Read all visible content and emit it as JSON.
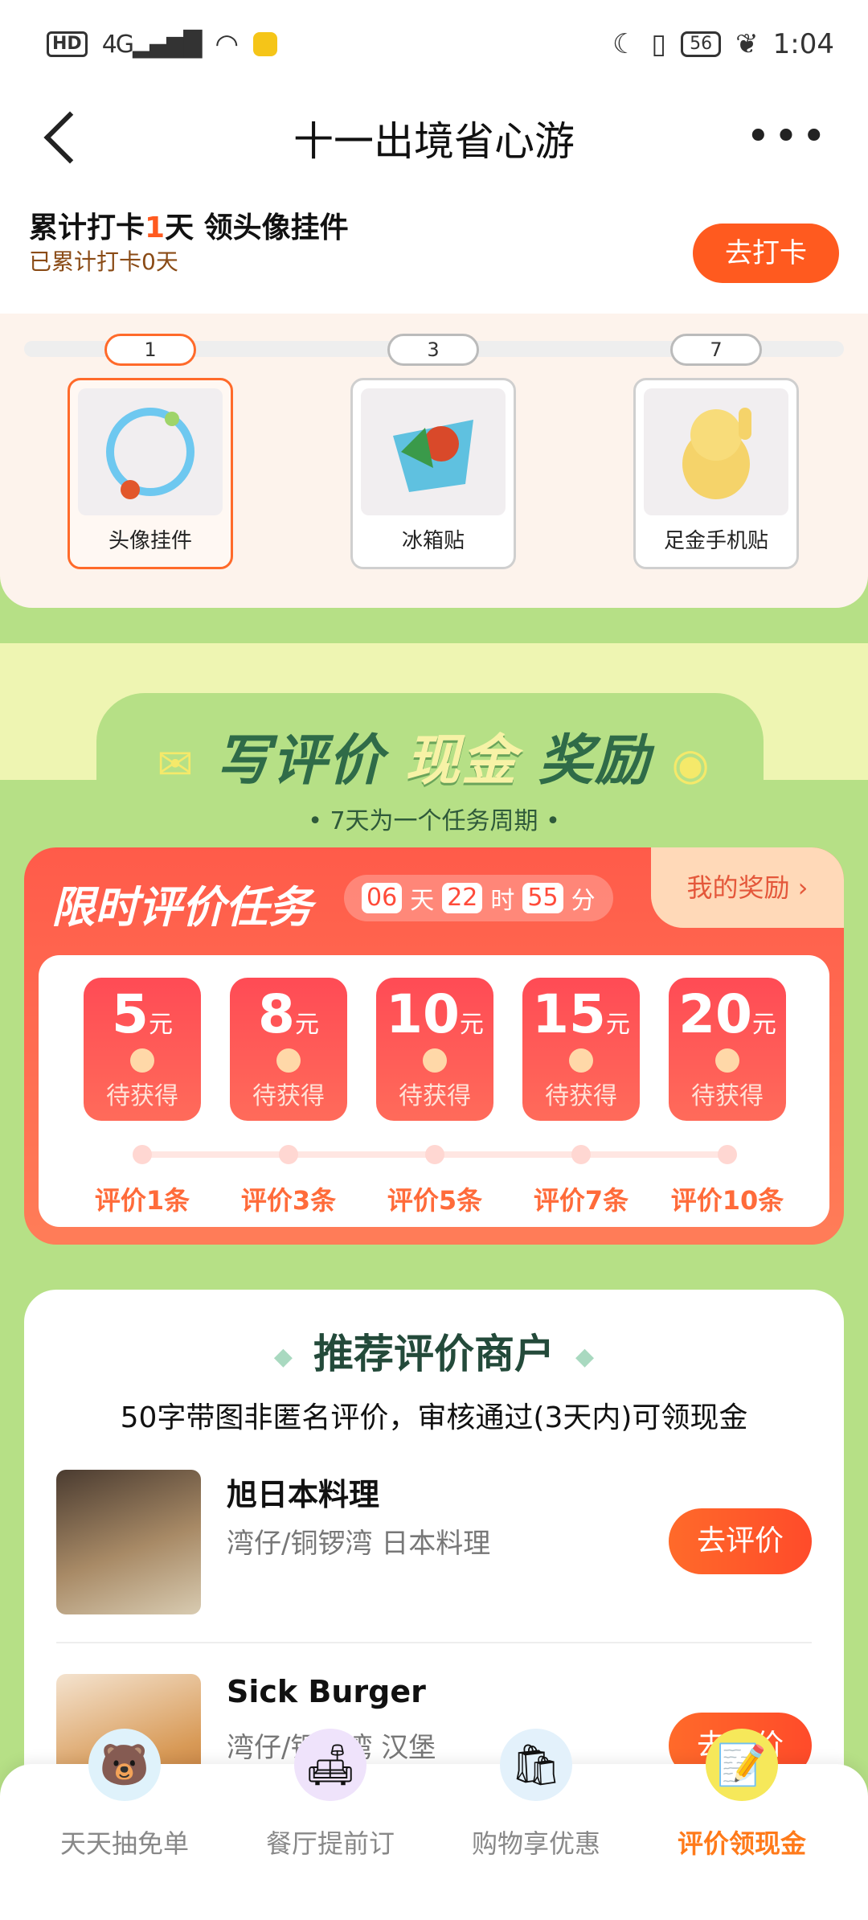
{
  "status": {
    "hd": "HD",
    "net": "4G",
    "battery": "56",
    "time": "1:04"
  },
  "header": {
    "title": "十一出境省心游"
  },
  "checkin": {
    "title_pre": "累计打卡",
    "title_num": "1",
    "title_post": "天 领头像挂件",
    "sub": "已累计打卡0天",
    "button": "去打卡"
  },
  "rewards": [
    {
      "day": "1",
      "label": "头像挂件"
    },
    {
      "day": "3",
      "label": "冰箱贴"
    },
    {
      "day": "7",
      "label": "足金手机贴"
    }
  ],
  "banner": {
    "p1": "写评价",
    "p2": "现金",
    "p3": "奖励",
    "sub": "• 7天为一个任务周期 •"
  },
  "task": {
    "title": "限时评价任务",
    "timer": {
      "d": "06",
      "d_label": "天",
      "h": "22",
      "h_label": "时",
      "m": "55",
      "m_label": "分"
    },
    "my_reward": "我的奖励 ›",
    "unit": "元",
    "items": [
      {
        "amount": "5",
        "status": "待获得",
        "req": "评价1条"
      },
      {
        "amount": "8",
        "status": "待获得",
        "req": "评价3条"
      },
      {
        "amount": "10",
        "status": "待获得",
        "req": "评价5条"
      },
      {
        "amount": "15",
        "status": "待获得",
        "req": "评价7条"
      },
      {
        "amount": "20",
        "status": "待获得",
        "req": "评价10条"
      }
    ]
  },
  "merchants": {
    "title": "推荐评价商户",
    "note": "50字带图非匿名评价，审核通过(3天内)可领现金",
    "items": [
      {
        "name": "旭日本料理",
        "location": "湾仔/铜锣湾 日本料理",
        "button": "去评价"
      },
      {
        "name": "Sick Burger",
        "location": "湾仔/铜锣湾 汉堡",
        "button": "去评价"
      }
    ]
  },
  "nav": [
    {
      "label": "天天抽免单",
      "icon": "bear-icon"
    },
    {
      "label": "餐厅提前订",
      "icon": "sofa-icon"
    },
    {
      "label": "购物享优惠",
      "icon": "shopping-bag-icon"
    },
    {
      "label": "评价领现金",
      "icon": "review-note-icon"
    }
  ],
  "colors": {
    "accent": "#ff5a1f",
    "green": "#b6e086",
    "red": "#ff5b4a"
  }
}
